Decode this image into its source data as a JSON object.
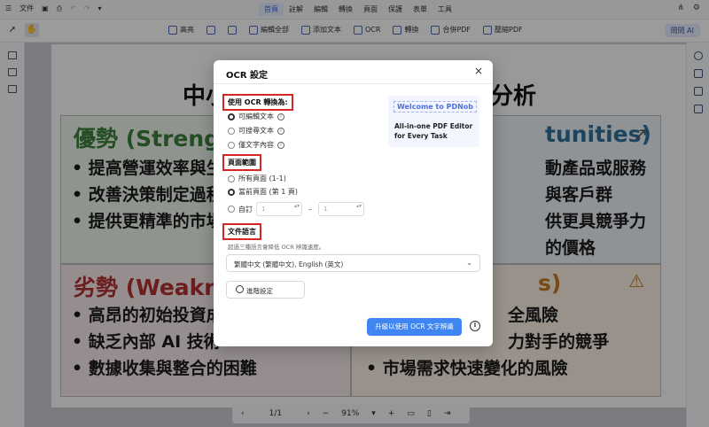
{
  "topbar": {
    "file_label": "文件",
    "menu": [
      "首頁",
      "註解",
      "編輯",
      "轉換",
      "頁面",
      "保護",
      "表單",
      "工具"
    ],
    "active_menu": "首頁"
  },
  "toolbar": {
    "tools": [
      "高亮",
      "",
      "",
      "編輯全部",
      "添加文本",
      "OCR",
      "轉換",
      "合併PDF",
      "壓縮PDF"
    ],
    "ai_label": "問問 AI"
  },
  "document": {
    "title_left": "中小",
    "title_right": "分析",
    "q1_heading": "優勢 (Strengths",
    "q1_bullets": [
      "• 提高營運效率與生",
      "• 改善決策制定過程",
      "• 提供更精準的市場"
    ],
    "q2_heading": "tunities)",
    "q2_bullets": [
      "動產品或服務",
      "與客戶群",
      "供更具競爭力的價格"
    ],
    "q3_heading": "劣勢 (Weakness",
    "q3_bullets": [
      "• 高昂的初始投資成",
      "• 缺乏內部 AI 技術",
      "• 數據收集與整合的困難"
    ],
    "q4_heading": "s)",
    "q4_bullets": [
      "全風險",
      "力對手的競爭",
      "• 市場需求快速變化的風險"
    ]
  },
  "bottombar": {
    "page_indicator": "1/1",
    "zoom": "91%"
  },
  "modal": {
    "title": "OCR 設定",
    "close": "×",
    "section_convert": "使用 OCR 轉換為:",
    "convert_options": [
      "可編輯文本",
      "可搜尋文本",
      "僅文字內容"
    ],
    "convert_selected": 0,
    "section_range": "頁面範圍",
    "range_options": [
      "所有頁面 (1-1)",
      "當前頁面 (第 1 頁)",
      "自訂"
    ],
    "range_selected": 1,
    "custom_from": "1",
    "custom_to": "1",
    "custom_dash": "–",
    "section_language": "文件語言",
    "language_note": "超過三種語言會降低 OCR 辨識速度。",
    "language_value": "繁體中文 (繁體中文), English (英文)",
    "advanced_label": "進階設定",
    "upgrade_label": "升級以使用 OCR 文字辨識",
    "promo_title": "Welcome to PDNob",
    "promo_text": "All-in-one PDF Editor for Every Task"
  },
  "colors": {
    "accent": "#3f86f2",
    "highlight_border": "#d62626",
    "strengths": "#3a7d3a",
    "opportunities": "#2f6f9a",
    "weaknesses": "#b13030",
    "threats": "#c07a20"
  }
}
